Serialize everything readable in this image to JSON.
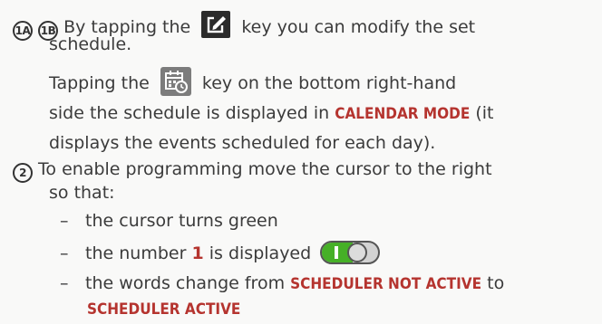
{
  "step1": {
    "badge_a": "1A",
    "badge_b": "1B",
    "line1_pre": "By tapping the",
    "line1_post": "key you can modify the set",
    "line2": "schedule.",
    "line3_pre": "Tapping the",
    "line3_post": "key on the bottom right-hand",
    "line4": "side the schedule is displayed in",
    "line4_highlight": "CALENDAR MODE",
    "line4_post": "(it",
    "line5": "displays the events scheduled for each day).",
    "edit_key_icon": "edit-key-icon",
    "calendar_key_icon": "calendar-clock-key-icon"
  },
  "step2": {
    "badge": "2",
    "line1": "To enable programming move the cursor to the right",
    "line2": "so that:",
    "bullets": {
      "dash": "–",
      "b1": "the cursor turns green",
      "b2_pre": "the number",
      "b2_number": "1",
      "b2_post": "is displayed",
      "b3_pre": "the words change from",
      "b3_from": "SCHEDULER NOT ACTIVE",
      "b3_to_word": "to",
      "b3_to": "SCHEDULER ACTIVE"
    },
    "toggle_state": "on",
    "toggle_color": "#46b027"
  },
  "colors": {
    "text": "#3b3b3b",
    "highlight": "#b5342f"
  }
}
